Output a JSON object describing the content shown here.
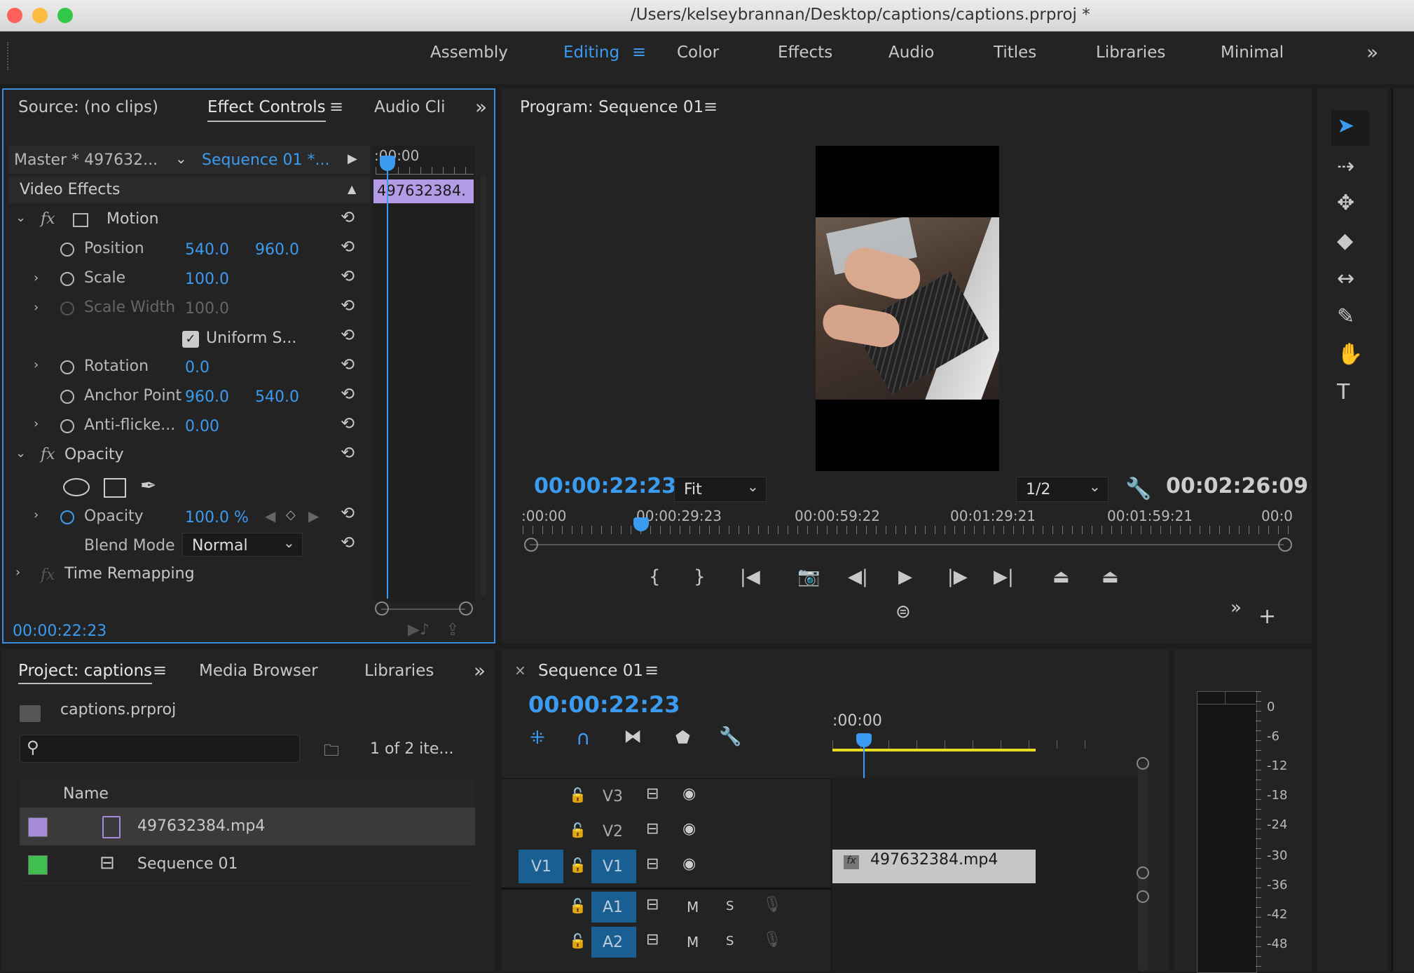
{
  "window": {
    "title": "/Users/kelseybrannan/Desktop/captions/captions.prproj *"
  },
  "workspaces": [
    "Assembly",
    "Editing",
    "Color",
    "Effects",
    "Audio",
    "Titles",
    "Libraries",
    "Minimal"
  ],
  "source_panel": {
    "tabs": {
      "source": "Source: (no clips)",
      "effect_controls": "Effect Controls",
      "audio_clip": "Audio Cli"
    },
    "master": "Master * 497632...",
    "sequence": "Sequence 01 *...",
    "ruler_time": ":00:00",
    "clip_label": "497632384.",
    "section": "Video Effects",
    "motion": "Motion",
    "props": {
      "position": {
        "label": "Position",
        "v1": "540.0",
        "v2": "960.0"
      },
      "scale": {
        "label": "Scale",
        "v1": "100.0"
      },
      "scale_width": {
        "label": "Scale Width",
        "v1": "100.0"
      },
      "uniform": {
        "label": "Uniform S..."
      },
      "rotation": {
        "label": "Rotation",
        "v1": "0.0"
      },
      "anchor": {
        "label": "Anchor Point",
        "v1": "960.0",
        "v2": "540.0"
      },
      "antiflicker": {
        "label": "Anti-flicke...",
        "v1": "0.00"
      },
      "opacity_section": "Opacity",
      "opacity": {
        "label": "Opacity",
        "v1": "100.0 %"
      },
      "blend": {
        "label": "Blend Mode",
        "value": "Normal"
      },
      "time_remap": "Time Remapping"
    },
    "timecode": "00:00:22:23"
  },
  "program": {
    "title": "Program: Sequence 01",
    "timecode": "00:00:22:23",
    "fit": "Fit",
    "resolution": "1/2",
    "duration": "00:02:26:09",
    "ruler": [
      ":00:00",
      "00:00:29:23",
      "00:00:59:22",
      "00:01:29:21",
      "00:01:59:21",
      "00:0"
    ]
  },
  "project": {
    "tabs": {
      "project": "Project: captions",
      "media": "Media Browser",
      "libraries": "Libraries"
    },
    "file": "captions.prproj",
    "search_placeholder": "",
    "count": "1 of 2 ite...",
    "col_name": "Name",
    "items": [
      {
        "name": "497632384.mp4",
        "color": "#a78bd8"
      },
      {
        "name": "Sequence 01",
        "color": "#3fbf4f"
      }
    ]
  },
  "timeline": {
    "title": "Sequence 01",
    "timecode": "00:00:22:23",
    "ruler_time": ":00:00",
    "tracks": {
      "v3": "V3",
      "v2": "V2",
      "v1": "V1",
      "a1": "A1",
      "a2": "A2"
    },
    "source_v1": "V1",
    "mute": "M",
    "solo": "S",
    "clip": "497632384.mp4",
    "fx": "fx"
  },
  "meter": {
    "labels": [
      "0",
      "-6",
      "-12",
      "-18",
      "-24",
      "-30",
      "-36",
      "-42",
      "-48"
    ]
  }
}
